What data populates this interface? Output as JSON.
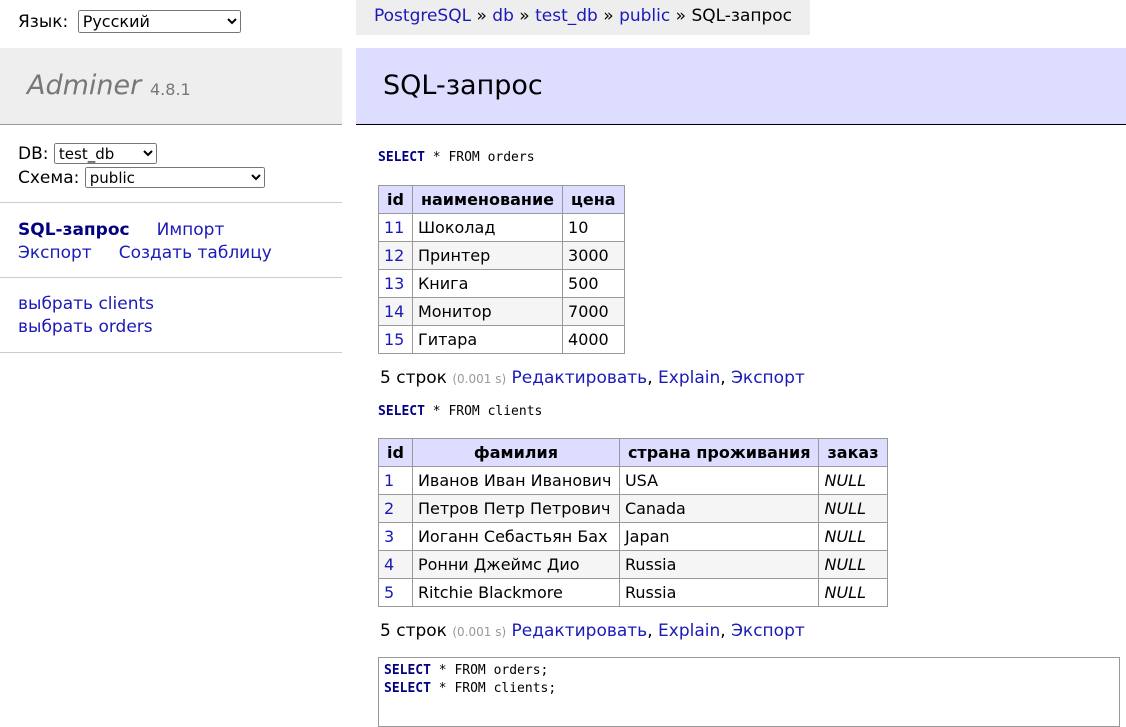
{
  "lang": {
    "label": "Язык:",
    "selected": "Русский"
  },
  "logo": {
    "name": "Adminer",
    "version": "4.8.1"
  },
  "db": {
    "db_label": "DB:",
    "db_value": "test_db",
    "schema_label": "Схема:",
    "schema_value": "public"
  },
  "menu": {
    "sql": "SQL-запрос",
    "import": "Импорт",
    "export": "Экспорт",
    "create_table": "Создать таблицу"
  },
  "tables": {
    "select_clients": "выбрать clients",
    "select_orders": "выбрать orders"
  },
  "breadcrumb": {
    "driver": "PostgreSQL",
    "sep": "»",
    "server": "db",
    "database": "test_db",
    "schema": "public",
    "current": "SQL-запрос"
  },
  "page": {
    "title": "SQL-запрос"
  },
  "query1": {
    "keyword": "SELECT",
    "rest": " * FROM orders",
    "headers": [
      "id",
      "наименование",
      "цена"
    ],
    "rows": [
      [
        "11",
        "Шоколад",
        "10"
      ],
      [
        "12",
        "Принтер",
        "3000"
      ],
      [
        "13",
        "Книга",
        "500"
      ],
      [
        "14",
        "Монитор",
        "7000"
      ],
      [
        "15",
        "Гитара",
        "4000"
      ]
    ],
    "summary": {
      "count": "5 строк",
      "time": "(0.001 s)",
      "edit": "Редактировать",
      "explain": "Explain",
      "export": "Экспорт",
      "comma": ","
    }
  },
  "query2": {
    "keyword": "SELECT",
    "rest": " * FROM clients",
    "headers": [
      "id",
      "фамилия",
      "страна проживания",
      "заказ"
    ],
    "rows": [
      [
        "1",
        "Иванов Иван Иванович",
        "USA",
        "NULL"
      ],
      [
        "2",
        "Петров Петр Петрович",
        "Canada",
        "NULL"
      ],
      [
        "3",
        "Иоганн Себастьян Бах",
        "Japan",
        "NULL"
      ],
      [
        "4",
        "Ронни Джеймс Дио",
        "Russia",
        "NULL"
      ],
      [
        "5",
        "Ritchie Blackmore",
        "Russia",
        "NULL"
      ]
    ],
    "summary": {
      "count": "5 строк",
      "time": "(0.001 s)",
      "edit": "Редактировать",
      "explain": "Explain",
      "export": "Экспорт",
      "comma": ","
    }
  },
  "editor": {
    "line1_kw": "SELECT",
    "line1_rest": " * FROM orders;",
    "line2_kw": "SELECT",
    "line2_rest": " * FROM clients;"
  }
}
